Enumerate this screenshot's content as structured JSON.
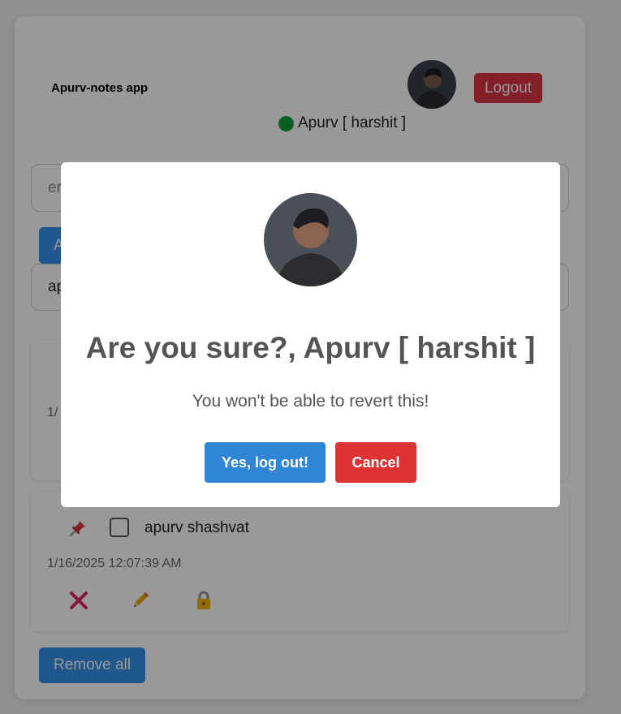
{
  "header": {
    "app_title": "Apurv-notes app",
    "logout_label": "Logout",
    "user_status": "Apurv [ harshit ]"
  },
  "form": {
    "note_placeholder": "enter note",
    "note_placeholder_visible": "er",
    "add_label_visible": "A",
    "search_value_visible": "ap"
  },
  "notes": [
    {
      "date_visible": "1/",
      "text": ""
    },
    {
      "text": "apurv shashvat",
      "date": "1/16/2025 12:07:39 AM",
      "pinned": true,
      "checked": false
    }
  ],
  "footer": {
    "remove_all_label": "Remove all"
  },
  "modal": {
    "title": "Are you sure?, Apurv [ harshit ]",
    "text": "You won't be able to revert this!",
    "confirm_label": "Yes, log out!",
    "cancel_label": "Cancel"
  },
  "colors": {
    "logout": "#dc3545",
    "primary": "#3590e8",
    "modal_confirm": "#3085d6",
    "modal_cancel": "#dd3333",
    "online": "#0f9d3d"
  },
  "icons": {
    "pin": "pushpin-icon",
    "delete": "cross-mark-icon",
    "edit": "pencil-icon",
    "lock": "lock-icon",
    "online": "online-dot-icon"
  }
}
